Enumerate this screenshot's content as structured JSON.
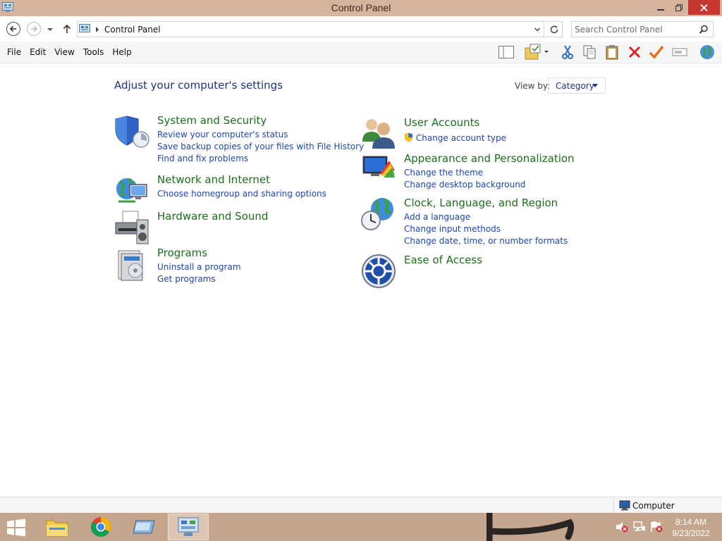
{
  "window": {
    "title": "Control Panel"
  },
  "address": {
    "crumb": "Control Panel",
    "search_placeholder": "Search Control Panel"
  },
  "menu": [
    "File",
    "Edit",
    "View",
    "Tools",
    "Help"
  ],
  "content": {
    "heading": "Adjust your computer's settings",
    "view_by_label": "View by:",
    "view_by_value": "Category"
  },
  "categories": {
    "system_security": {
      "title": "System and Security",
      "links": [
        "Review your computer's status",
        "Save backup copies of your files with File History",
        "Find and fix problems"
      ]
    },
    "network": {
      "title": "Network and Internet",
      "links": [
        "Choose homegroup and sharing options"
      ]
    },
    "hardware": {
      "title": "Hardware and Sound"
    },
    "programs": {
      "title": "Programs",
      "links": [
        "Uninstall a program",
        "Get programs"
      ]
    },
    "user_accounts": {
      "title": "User Accounts",
      "links": [
        "Change account type"
      ]
    },
    "appearance": {
      "title": "Appearance and Personalization",
      "links": [
        "Change the theme",
        "Change desktop background"
      ]
    },
    "clock": {
      "title": "Clock, Language, and Region",
      "links": [
        "Add a language",
        "Change input methods",
        "Change date, time, or number formats"
      ]
    },
    "ease": {
      "title": "Ease of Access"
    }
  },
  "statusbar": {
    "location": "Computer"
  },
  "taskbar": {
    "time": "8:14 AM",
    "date": "9/23/2022"
  },
  "colors": {
    "titlebar": "#d5b49b",
    "taskbar": "#c4a58e",
    "category_title": "#1b6f1b",
    "link": "#1e46b4",
    "heading": "#1e3287",
    "close": "#c7372f"
  }
}
